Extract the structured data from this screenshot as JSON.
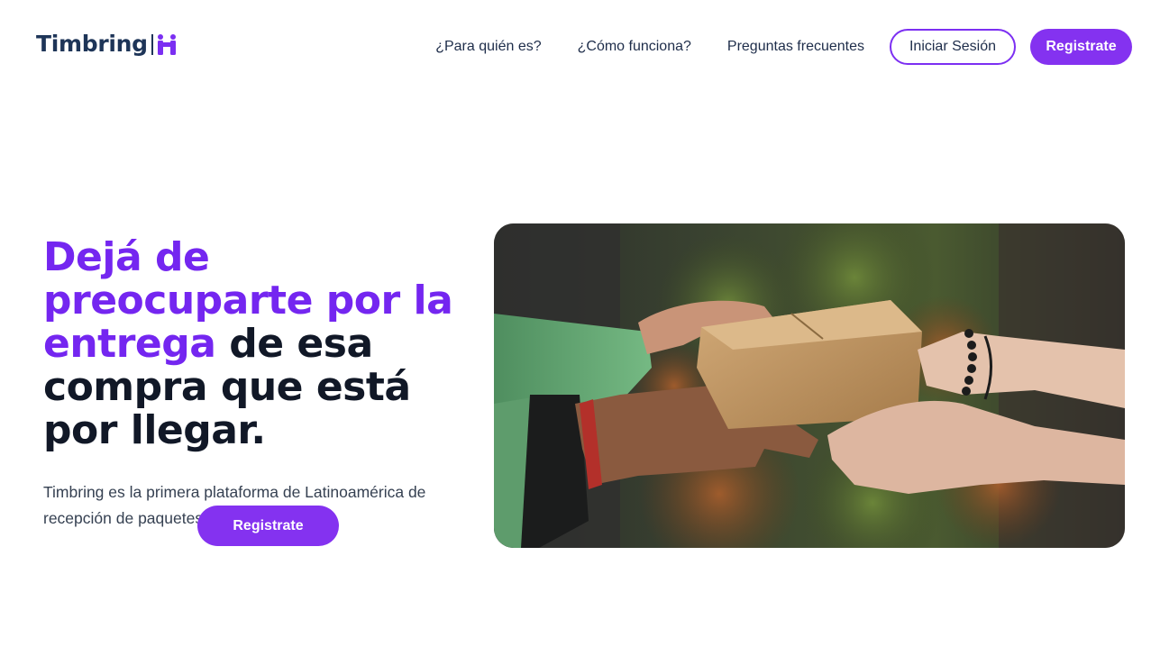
{
  "brand": {
    "name": "Timbring"
  },
  "nav": {
    "links": [
      "¿Para quién es?",
      "¿Cómo funciona?",
      "Preguntas frecuentes"
    ],
    "login_label": "Iniciar Sesión",
    "register_label": "Registrate"
  },
  "hero": {
    "title_accent": "Dejá de preocuparte por la entrega",
    "title_rest": " de esa compra que está por llegar.",
    "description": "Timbring es la primera plataforma de Latinoamérica de recepción de paquetes colaborativa.",
    "cta_label": "Registrate",
    "image_alt": "hands passing a cardboard box"
  },
  "colors": {
    "accent": "#8432f0",
    "title_accent": "#7426f0",
    "brand_navy": "#1e3558",
    "heading": "#111827"
  },
  "icons": [
    "two-people-handing-box-icon"
  ]
}
